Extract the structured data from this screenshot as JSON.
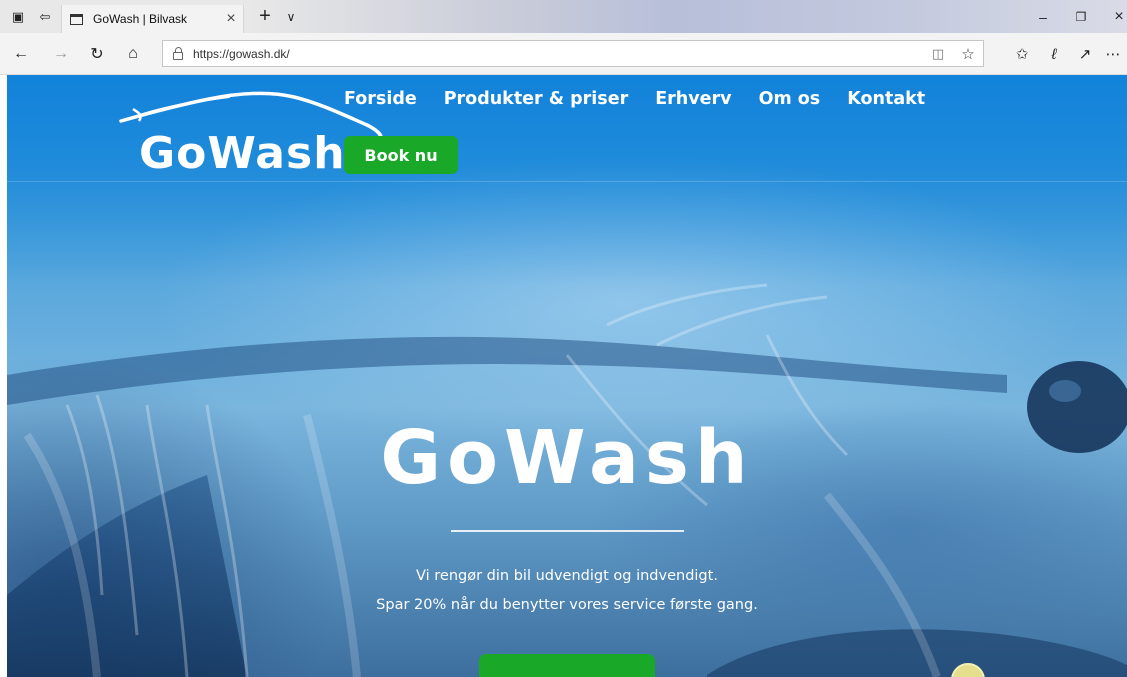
{
  "browser": {
    "tab": {
      "title": "GoWash | Bilvask"
    },
    "address": {
      "url": "https://gowash.dk/"
    }
  },
  "site": {
    "logo_text": "GoWash",
    "nav": [
      {
        "label": "Forside"
      },
      {
        "label": "Produkter & priser"
      },
      {
        "label": "Erhverv"
      },
      {
        "label": "Om os"
      },
      {
        "label": "Kontakt"
      }
    ],
    "book_button": "Book nu"
  },
  "hero": {
    "title": "GoWash",
    "line1": "Vi rengør din bil udvendigt og indvendigt.",
    "line2": "Spar 20% når du benytter vores service første gang."
  },
  "colors": {
    "accent_green": "#1aa829",
    "hero_blue": "#1b8fd8"
  }
}
